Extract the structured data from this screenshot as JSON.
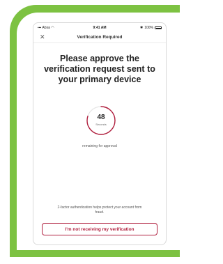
{
  "status_bar": {
    "carrier": "Absa",
    "time": "9:41 AM",
    "battery_text": "100%"
  },
  "nav": {
    "title": "Verification Required",
    "close_icon": "close-icon"
  },
  "headline": "Please approve the verification request sent to your primary device",
  "timer": {
    "value": "48",
    "unit": "Seconds",
    "progress_fraction": 0.8
  },
  "remaining_text": "remaining for approval",
  "footnote": "2-factor authentication helps protect your account from fraud.",
  "action_button_label": "I'm not receiving my verification",
  "colors": {
    "accent": "#b01f3e",
    "frame_green": "#7dc242"
  }
}
